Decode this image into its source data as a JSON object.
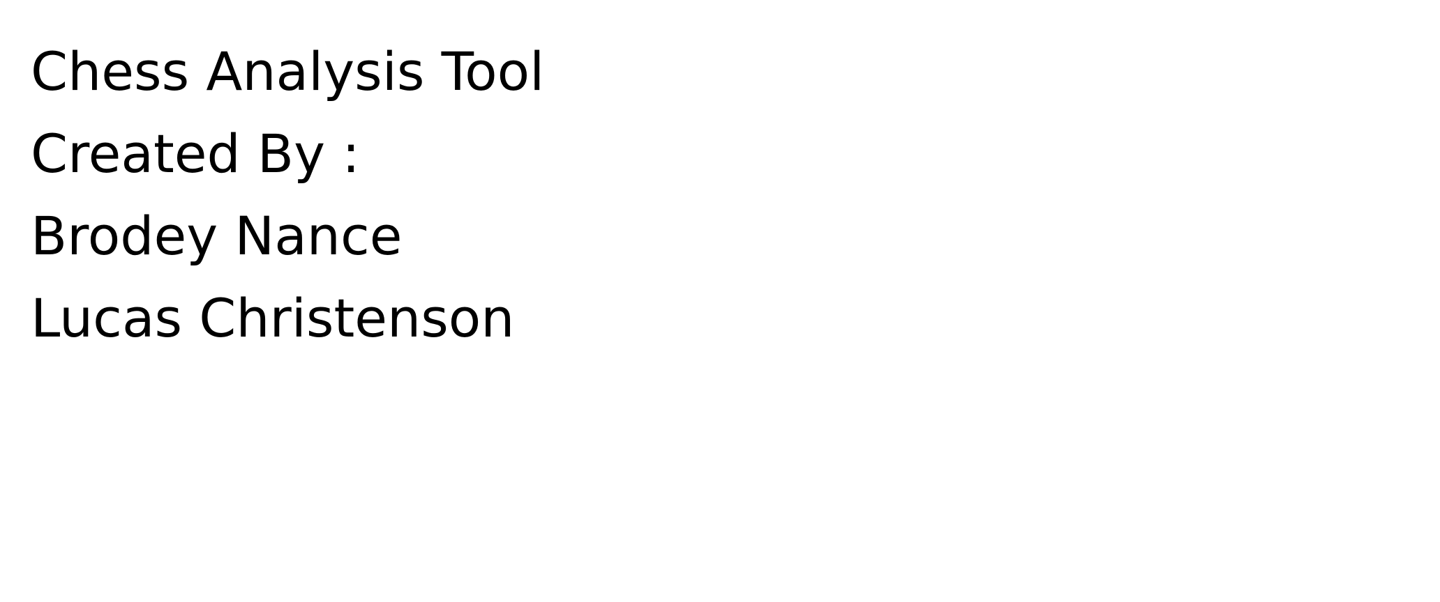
{
  "document": {
    "title": "Chess Analysis Tool",
    "credits_label": "Created By :",
    "authors": [
      "Brodey Nance",
      "Lucas Christenson"
    ]
  },
  "colors": {
    "background": "#ffffff",
    "text": "#000000"
  }
}
